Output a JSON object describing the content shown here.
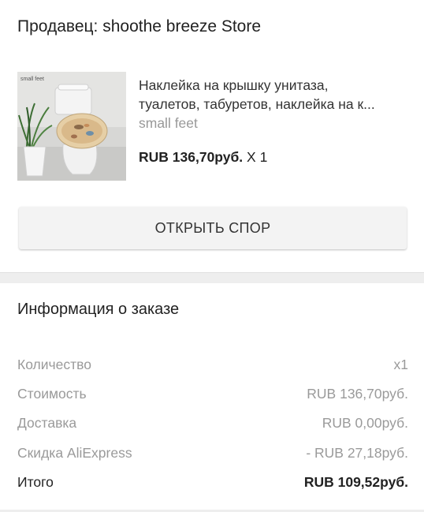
{
  "seller": {
    "label": "Продавец: shoothe breeze Store"
  },
  "product": {
    "title_line1": "Наклейка на крышку унитаза,",
    "title_line2": "туалетов, табуретов, наклейка на к...",
    "variant": "small feet",
    "price": "RUB 136,70руб.",
    "quantity": " X 1",
    "image_caption": "small feet"
  },
  "actions": {
    "dispute_label": "ОТКРЫТЬ СПОР"
  },
  "order_info": {
    "title": "Информация о заказе",
    "rows": [
      {
        "label": "Количество",
        "value": "x1"
      },
      {
        "label": "Стоимость",
        "value": "RUB 136,70руб."
      },
      {
        "label": "Доставка",
        "value": "RUB 0,00руб."
      },
      {
        "label": "Скидка AliExpress",
        "value": "- RUB 27,18руб."
      }
    ],
    "total": {
      "label": "Итого",
      "value": "RUB 109,52руб."
    }
  }
}
